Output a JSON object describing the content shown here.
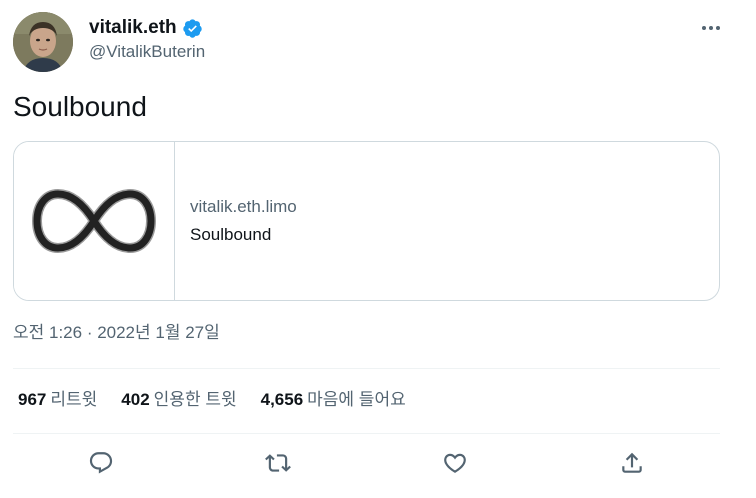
{
  "author": {
    "display_name": "vitalik.eth",
    "handle": "@VitalikButerin",
    "verified": true,
    "avatar_icon": "profile-photo"
  },
  "tweet": {
    "text": "Soulbound"
  },
  "link_card": {
    "domain": "vitalik.eth.limo",
    "title": "Soulbound",
    "thumbnail_icon": "infinity-icon"
  },
  "timestamp": "오전 1:26 · 2022년 1월 27일",
  "stats": [
    {
      "count": "967",
      "label": "리트윗"
    },
    {
      "count": "402",
      "label": "인용한 트윗"
    },
    {
      "count": "4,656",
      "label": "마음에 들어요"
    }
  ],
  "actions": [
    {
      "name": "reply",
      "icon": "reply-icon"
    },
    {
      "name": "retweet",
      "icon": "retweet-icon"
    },
    {
      "name": "like",
      "icon": "heart-icon"
    },
    {
      "name": "share",
      "icon": "share-icon"
    }
  ],
  "colors": {
    "text_primary": "#0f1419",
    "text_secondary": "#536471",
    "border": "#cfd9de",
    "divider": "#eff3f4",
    "verified": "#1d9bf0"
  }
}
